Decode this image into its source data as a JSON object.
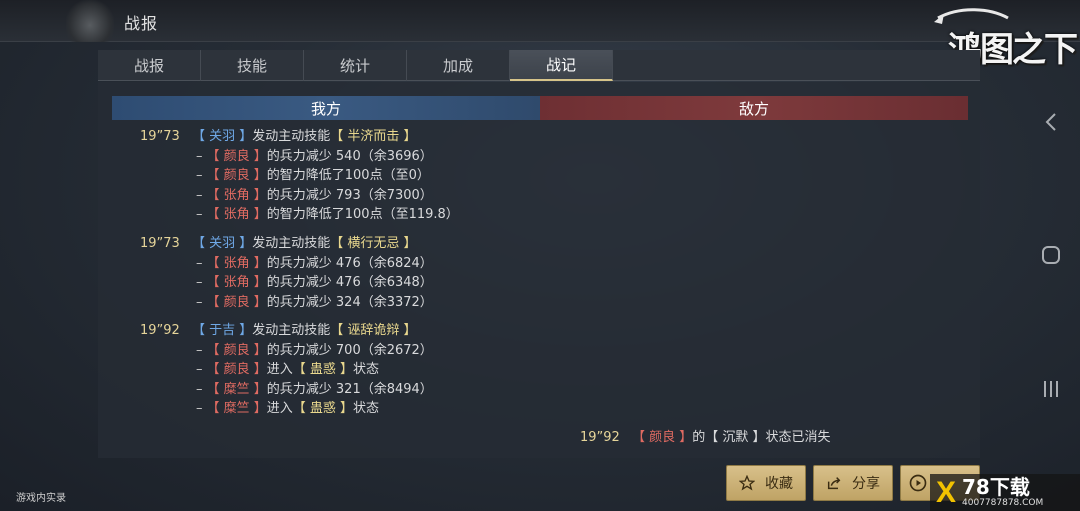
{
  "header": {
    "title": "战报"
  },
  "logo": {
    "text": "鸿图之下"
  },
  "tabs": [
    {
      "label": "战报",
      "active": false
    },
    {
      "label": "技能",
      "active": false
    },
    {
      "label": "统计",
      "active": false
    },
    {
      "label": "加成",
      "active": false
    },
    {
      "label": "战记",
      "active": true
    }
  ],
  "sides": {
    "ours": "我方",
    "theirs": "敌方"
  },
  "log": {
    "e1": {
      "time": "19”73",
      "actor": "【 关羽 】",
      "action": "发动主动技能",
      "skill": "【 半济而击 】"
    },
    "e1a": {
      "target": "【 颜良 】",
      "text": "的兵力减少 540（余3696）"
    },
    "e1b": {
      "target": "【 颜良 】",
      "text": "的智力降低了100点（至0）"
    },
    "e1c": {
      "target": "【 张角 】",
      "text": "的兵力减少 793（余7300）"
    },
    "e1d": {
      "target": "【 张角 】",
      "text": "的智力降低了100点（至119.8）"
    },
    "e2": {
      "time": "19”73",
      "actor": "【 关羽 】",
      "action": "发动主动技能",
      "skill": "【 横行无忌 】"
    },
    "e2a": {
      "target": "【 张角 】",
      "text": "的兵力减少 476（余6824）"
    },
    "e2b": {
      "target": "【 张角 】",
      "text": "的兵力减少 476（余6348）"
    },
    "e2c": {
      "target": "【 颜良 】",
      "text": "的兵力减少 324（余3372）"
    },
    "e3": {
      "time": "19”92",
      "actor": "【 于吉 】",
      "action": "发动主动技能",
      "skill": "【 诬辞诡辩 】"
    },
    "e3a": {
      "target": "【 颜良 】",
      "text": "的兵力减少 700（余2672）"
    },
    "e3b": {
      "target": "【 颜良 】",
      "pre": "进入",
      "state": "【 蛊惑 】",
      "post": "状态"
    },
    "e3c": {
      "target": "【 糜竺 】",
      "text": "的兵力减少 321（余8494）"
    },
    "e3d": {
      "target": "【 糜竺 】",
      "pre": "进入",
      "state": "【 蛊惑 】",
      "post": "状态"
    },
    "e4": {
      "time": "19”92",
      "target": "【 颜良 】",
      "mid": "的【 沉默 】",
      "post": "状态已消失"
    }
  },
  "buttons": {
    "favorite": "收藏",
    "share": "分享"
  },
  "watermark": {
    "left": "游戏内实录",
    "brand_x": "X",
    "brand": "78下载",
    "url": "4007787878.COM"
  },
  "colors": {
    "ally_name": "#6fa8e6",
    "enemy_name": "#e06b62",
    "skill": "#e9d88e",
    "time": "#e6d59a",
    "button": "#d8c08a"
  }
}
